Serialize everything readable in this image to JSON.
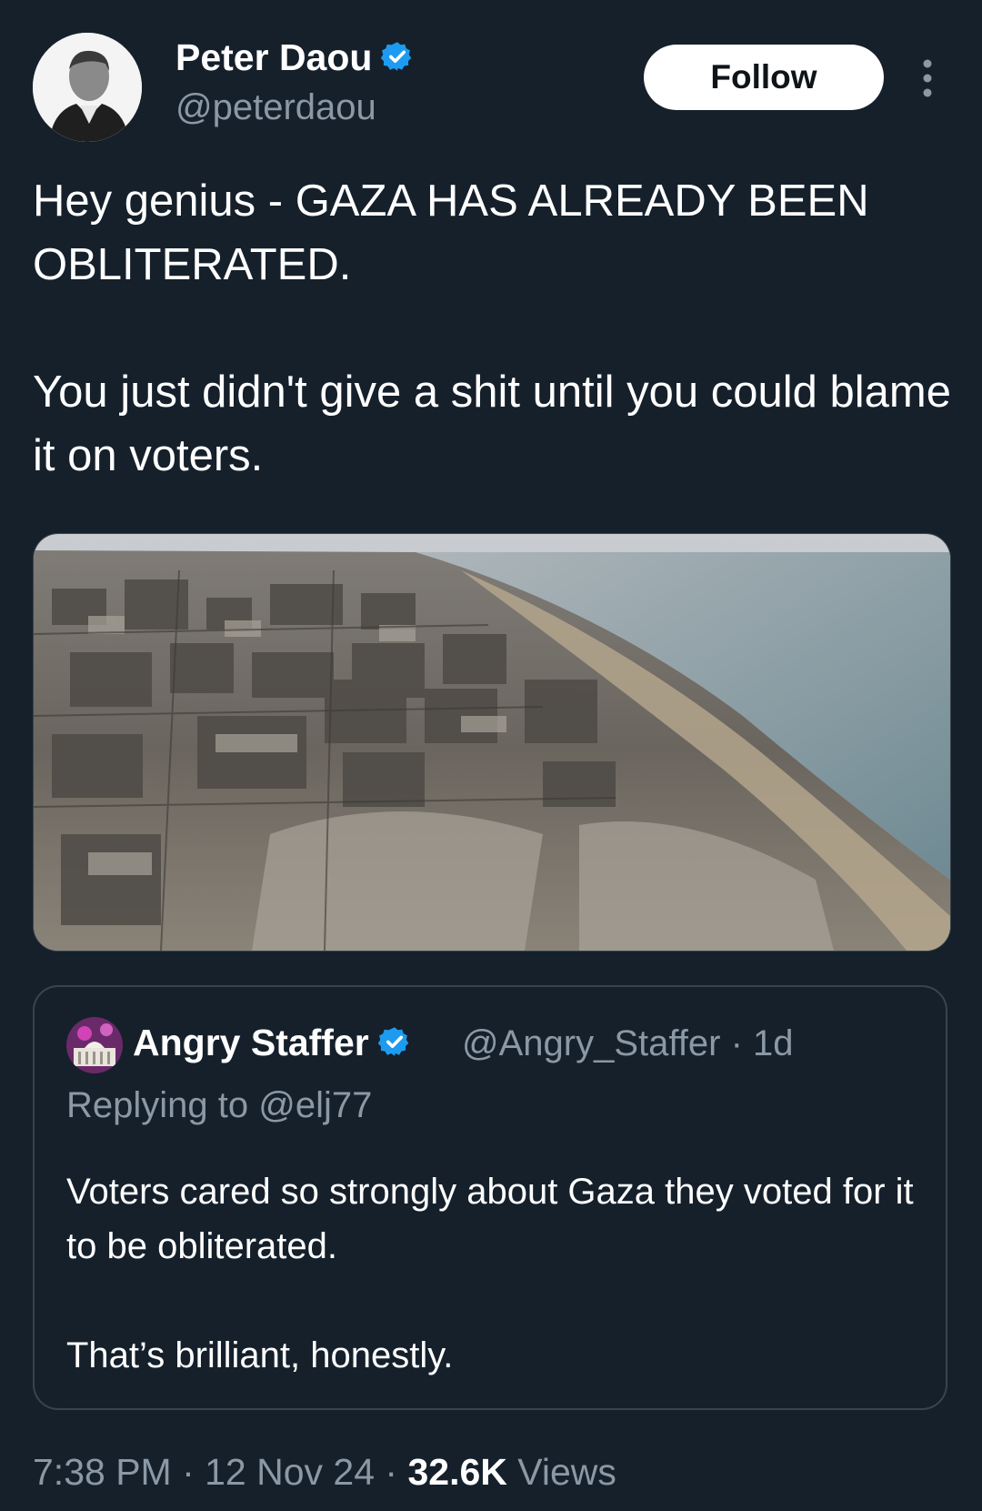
{
  "author": {
    "name": "Peter Daou",
    "handle": "@peterdaou",
    "verified_icon": "verified-badge-icon"
  },
  "follow_label": "Follow",
  "tweet": {
    "line1": "Hey genius - GAZA HAS ALREADY BEEN OBLITERATED.",
    "line2": "You just didn't give a shit until you could blame it on voters."
  },
  "quoted": {
    "name": "Angry Staffer",
    "handle": "@Angry_Staffer · 1d",
    "replying": "Replying to @elj77",
    "text1": "Voters cared so strongly about Gaza they voted for it to be obliterated.",
    "text2": "That’s brilliant, honestly."
  },
  "meta": {
    "time": "7:38 PM · 12 Nov 24 · ",
    "views_count": "32.6K",
    "views_label": " Views"
  },
  "colors": {
    "background": "#15202b",
    "secondary_text": "#8b98a5",
    "verified_blue": "#1d9bf0",
    "border": "#38444d"
  }
}
